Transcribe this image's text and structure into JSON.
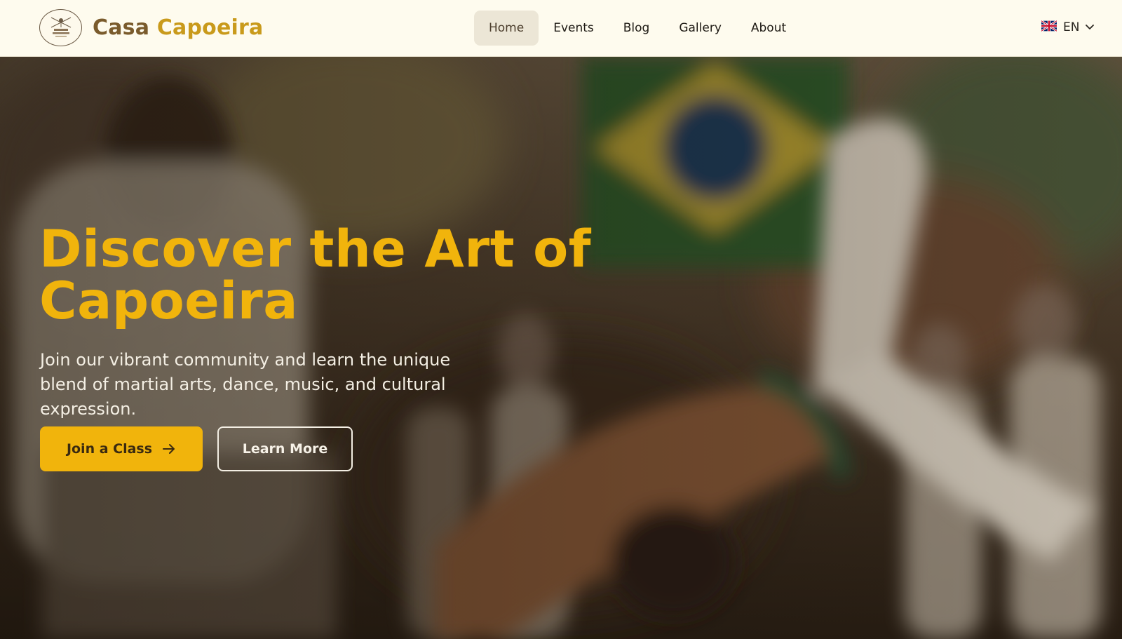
{
  "header": {
    "brand_part1": "Casa ",
    "brand_part2": "Capoeira",
    "logo_icon": "capoeira-logo-icon",
    "nav": [
      {
        "label": "Home",
        "active": true
      },
      {
        "label": "Events",
        "active": false
      },
      {
        "label": "Blog",
        "active": false
      },
      {
        "label": "Gallery",
        "active": false
      },
      {
        "label": "About",
        "active": false
      }
    ],
    "language": {
      "code": "EN",
      "flag_icon": "uk-flag-icon",
      "chevron_icon": "chevron-down-icon"
    }
  },
  "hero": {
    "title": "Discover the Art of Capoeira",
    "subtitle": "Join our vibrant community and learn the unique blend of martial arts, dance, music, and cultural expression.",
    "primary_button": "Join a Class",
    "primary_button_icon": "arrow-right-icon",
    "secondary_button": "Learn More"
  },
  "colors": {
    "accent": "#f1b40c",
    "header_bg": "#fefbee",
    "brand_dark": "#7a5b2c",
    "brand_gold": "#c99a1b",
    "nav_active_bg": "#ece6d6"
  }
}
